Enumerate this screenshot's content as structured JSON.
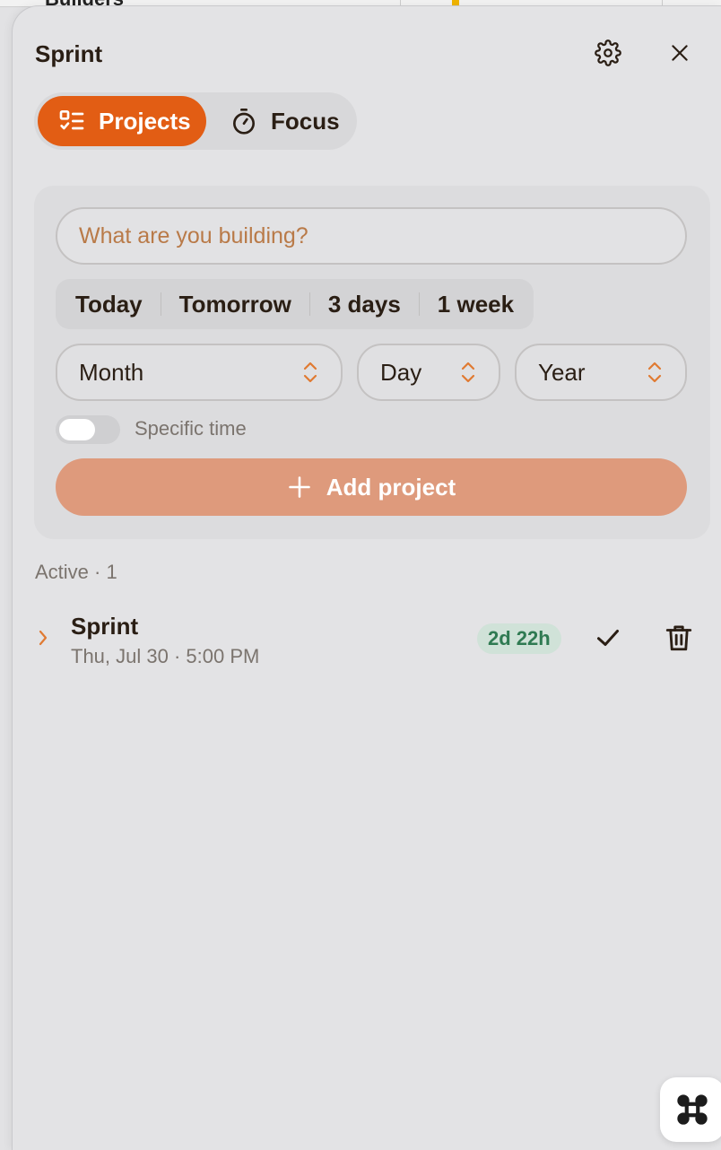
{
  "background": {
    "crumb": "Builders"
  },
  "header": {
    "title": "Sprint"
  },
  "tabs": [
    {
      "label": "Projects",
      "active": true,
      "icon": "checklist-icon"
    },
    {
      "label": "Focus",
      "active": false,
      "icon": "stopwatch-icon"
    }
  ],
  "form": {
    "placeholder": "What are you building?",
    "value": "",
    "quick_options": [
      "Today",
      "Tomorrow",
      "3 days",
      "1 week"
    ],
    "month_label": "Month",
    "day_label": "Day",
    "year_label": "Year",
    "toggle_label": "Specific time",
    "toggle_on": false,
    "add_label": "Add project"
  },
  "list": {
    "section_label": "Active · 1",
    "items": [
      {
        "name": "Sprint",
        "date": "Thu, Jul 30 · 5:00 PM",
        "remaining": "2d 22h"
      }
    ]
  },
  "colors": {
    "accent": "#e25d14",
    "add_button": "#de9a7c",
    "badge_bg": "#d0e2d8",
    "badge_text": "#2f7a52",
    "placeholder": "#b97a48"
  }
}
